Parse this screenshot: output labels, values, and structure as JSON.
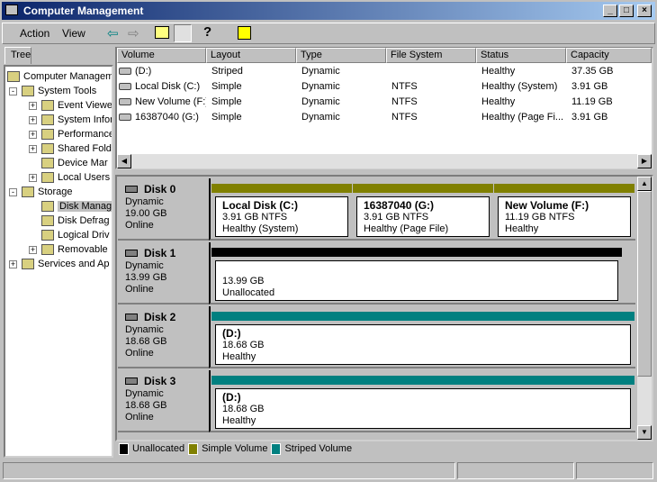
{
  "window": {
    "title": "Computer Management"
  },
  "menu": {
    "action": "Action",
    "view": "View"
  },
  "tree": {
    "tab": "Tree",
    "items": [
      {
        "label": "Computer Managem",
        "level": 0
      },
      {
        "label": "System Tools",
        "level": 1,
        "exp": "-"
      },
      {
        "label": "Event Viewe",
        "level": 2,
        "exp": "+"
      },
      {
        "label": "System Infor",
        "level": 2,
        "exp": "+"
      },
      {
        "label": "Performance",
        "level": 2,
        "exp": "+"
      },
      {
        "label": "Shared Fold",
        "level": 2,
        "exp": "+"
      },
      {
        "label": "Device Mar",
        "level": 2,
        "exp": ""
      },
      {
        "label": "Local Users",
        "level": 2,
        "exp": "+"
      },
      {
        "label": "Storage",
        "level": 1,
        "exp": "-"
      },
      {
        "label": "Disk Manag",
        "level": 2,
        "exp": "",
        "selected": true
      },
      {
        "label": "Disk Defrag",
        "level": 2,
        "exp": ""
      },
      {
        "label": "Logical Driv",
        "level": 2,
        "exp": ""
      },
      {
        "label": "Removable",
        "level": 2,
        "exp": "+"
      },
      {
        "label": "Services and Ap",
        "level": 1,
        "exp": "+"
      }
    ]
  },
  "volumes": {
    "columns": [
      "Volume",
      "Layout",
      "Type",
      "File System",
      "Status",
      "Capacity"
    ],
    "rows": [
      [
        "(D:)",
        "Striped",
        "Dynamic",
        "",
        "Healthy",
        "37.35 GB"
      ],
      [
        "Local Disk (C:)",
        "Simple",
        "Dynamic",
        "NTFS",
        "Healthy (System)",
        "3.91 GB"
      ],
      [
        "New Volume (F:)",
        "Simple",
        "Dynamic",
        "NTFS",
        "Healthy",
        "11.19 GB"
      ],
      [
        "16387040 (G:)",
        "Simple",
        "Dynamic",
        "NTFS",
        "Healthy (Page Fi...",
        "3.91 GB"
      ]
    ]
  },
  "disks": [
    {
      "name": "Disk 0",
      "type": "Dynamic",
      "size": "19.00 GB",
      "state": "Online",
      "parts": [
        {
          "title": "Local Disk  (C:)",
          "line1": "3.91 GB NTFS",
          "line2": "Healthy (System)",
          "kind": "simple"
        },
        {
          "title": "16387040  (G:)",
          "line1": "3.91 GB NTFS",
          "line2": "Healthy (Page File)",
          "kind": "simple"
        },
        {
          "title": "New Volume  (F:)",
          "line1": "11.19 GB NTFS",
          "line2": "Healthy",
          "kind": "simple"
        }
      ]
    },
    {
      "name": "Disk 1",
      "type": "Dynamic",
      "size": "13.99 GB",
      "state": "Online",
      "parts": [
        {
          "title": "",
          "line1": "13.99 GB",
          "line2": "Unallocated",
          "kind": "unallocated"
        }
      ]
    },
    {
      "name": "Disk 2",
      "type": "Dynamic",
      "size": "18.68 GB",
      "state": "Online",
      "parts": [
        {
          "title": "(D:)",
          "line1": "18.68 GB",
          "line2": "Healthy",
          "kind": "striped"
        }
      ]
    },
    {
      "name": "Disk 3",
      "type": "Dynamic",
      "size": "18.68 GB",
      "state": "Online",
      "parts": [
        {
          "title": "(D:)",
          "line1": "18.68 GB",
          "line2": "Healthy",
          "kind": "striped"
        }
      ]
    }
  ],
  "legend": [
    {
      "label": "Unallocated",
      "color": "#000000"
    },
    {
      "label": "Simple Volume",
      "color": "#808000"
    },
    {
      "label": "Striped Volume",
      "color": "#008080"
    }
  ]
}
